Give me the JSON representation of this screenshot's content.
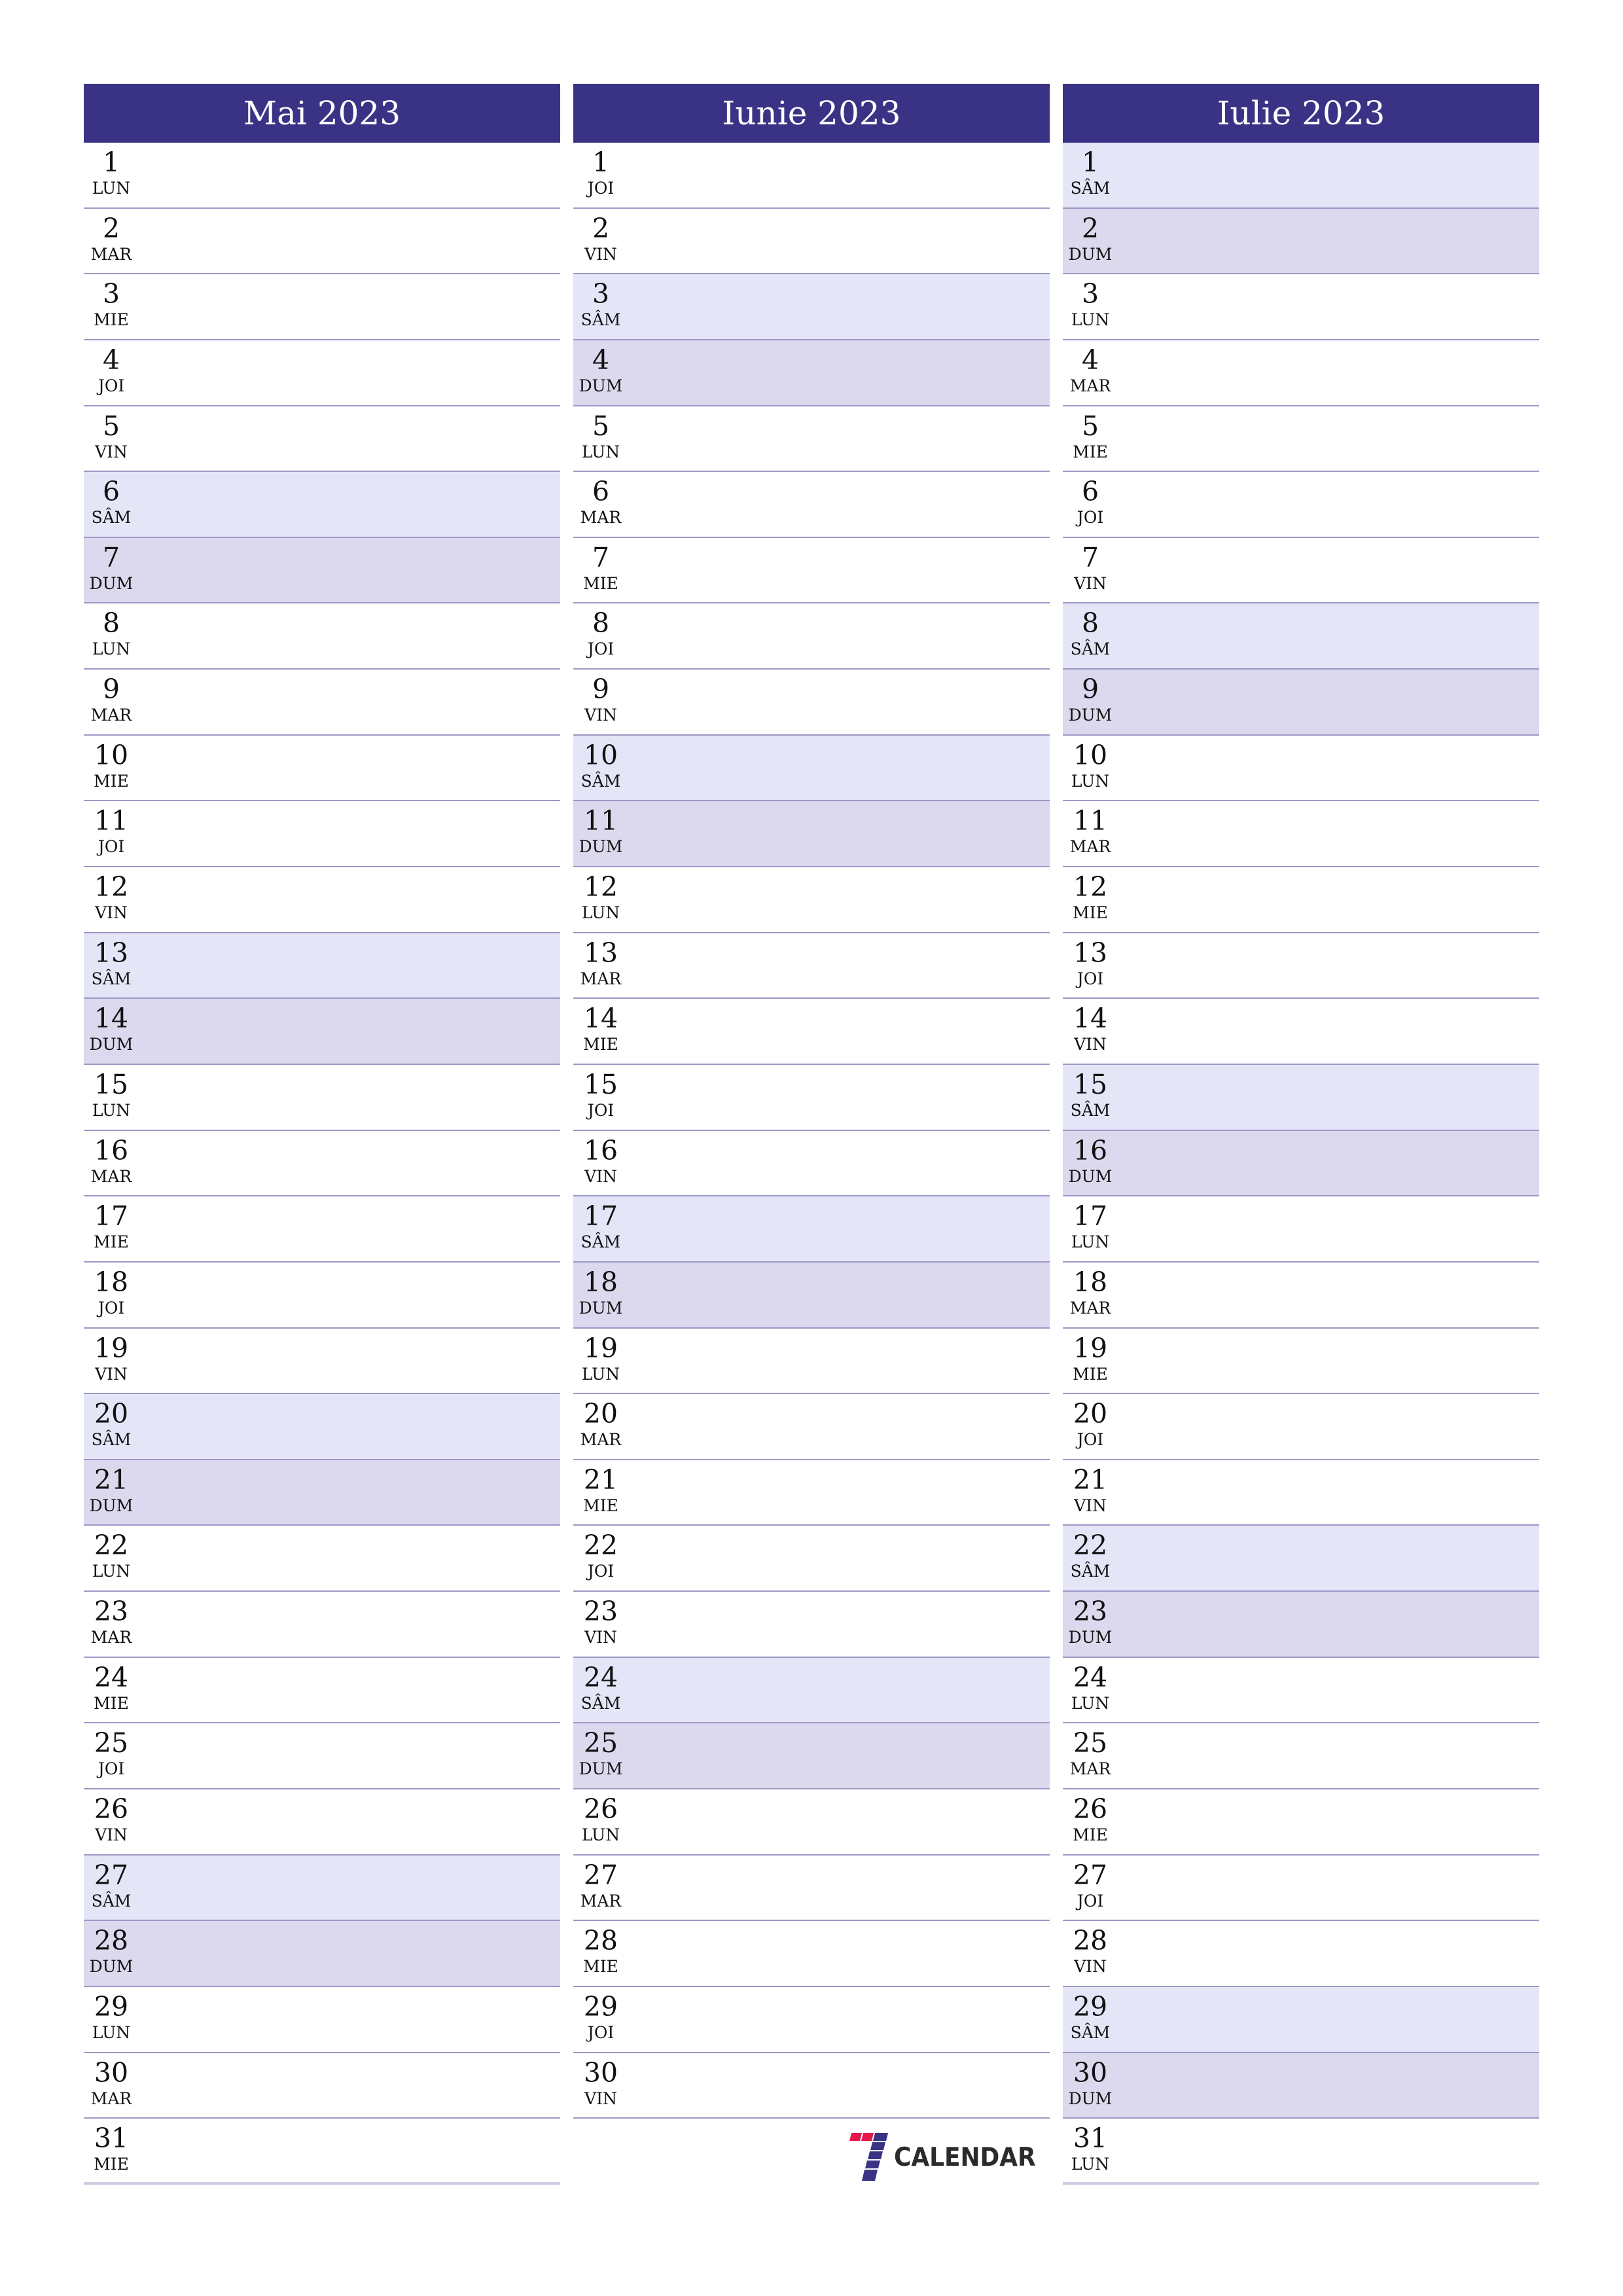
{
  "colors": {
    "header": "#3a3385",
    "saturday": "#e5e5f8",
    "sunday": "#dcd8ed",
    "divider": "#9d98c6",
    "logo_red": "#e8174a",
    "logo_blue": "#3a3385",
    "logo_text": "#2b2b2b"
  },
  "months": [
    {
      "title": "Mai 2023",
      "days": [
        {
          "n": "1",
          "d": "LUN"
        },
        {
          "n": "2",
          "d": "MAR"
        },
        {
          "n": "3",
          "d": "MIE"
        },
        {
          "n": "4",
          "d": "JOI"
        },
        {
          "n": "5",
          "d": "VIN"
        },
        {
          "n": "6",
          "d": "SÂM"
        },
        {
          "n": "7",
          "d": "DUM"
        },
        {
          "n": "8",
          "d": "LUN"
        },
        {
          "n": "9",
          "d": "MAR"
        },
        {
          "n": "10",
          "d": "MIE"
        },
        {
          "n": "11",
          "d": "JOI"
        },
        {
          "n": "12",
          "d": "VIN"
        },
        {
          "n": "13",
          "d": "SÂM"
        },
        {
          "n": "14",
          "d": "DUM"
        },
        {
          "n": "15",
          "d": "LUN"
        },
        {
          "n": "16",
          "d": "MAR"
        },
        {
          "n": "17",
          "d": "MIE"
        },
        {
          "n": "18",
          "d": "JOI"
        },
        {
          "n": "19",
          "d": "VIN"
        },
        {
          "n": "20",
          "d": "SÂM"
        },
        {
          "n": "21",
          "d": "DUM"
        },
        {
          "n": "22",
          "d": "LUN"
        },
        {
          "n": "23",
          "d": "MAR"
        },
        {
          "n": "24",
          "d": "MIE"
        },
        {
          "n": "25",
          "d": "JOI"
        },
        {
          "n": "26",
          "d": "VIN"
        },
        {
          "n": "27",
          "d": "SÂM"
        },
        {
          "n": "28",
          "d": "DUM"
        },
        {
          "n": "29",
          "d": "LUN"
        },
        {
          "n": "30",
          "d": "MAR"
        },
        {
          "n": "31",
          "d": "MIE"
        }
      ]
    },
    {
      "title": "Iunie 2023",
      "days": [
        {
          "n": "1",
          "d": "JOI"
        },
        {
          "n": "2",
          "d": "VIN"
        },
        {
          "n": "3",
          "d": "SÂM"
        },
        {
          "n": "4",
          "d": "DUM"
        },
        {
          "n": "5",
          "d": "LUN"
        },
        {
          "n": "6",
          "d": "MAR"
        },
        {
          "n": "7",
          "d": "MIE"
        },
        {
          "n": "8",
          "d": "JOI"
        },
        {
          "n": "9",
          "d": "VIN"
        },
        {
          "n": "10",
          "d": "SÂM"
        },
        {
          "n": "11",
          "d": "DUM"
        },
        {
          "n": "12",
          "d": "LUN"
        },
        {
          "n": "13",
          "d": "MAR"
        },
        {
          "n": "14",
          "d": "MIE"
        },
        {
          "n": "15",
          "d": "JOI"
        },
        {
          "n": "16",
          "d": "VIN"
        },
        {
          "n": "17",
          "d": "SÂM"
        },
        {
          "n": "18",
          "d": "DUM"
        },
        {
          "n": "19",
          "d": "LUN"
        },
        {
          "n": "20",
          "d": "MAR"
        },
        {
          "n": "21",
          "d": "MIE"
        },
        {
          "n": "22",
          "d": "JOI"
        },
        {
          "n": "23",
          "d": "VIN"
        },
        {
          "n": "24",
          "d": "SÂM"
        },
        {
          "n": "25",
          "d": "DUM"
        },
        {
          "n": "26",
          "d": "LUN"
        },
        {
          "n": "27",
          "d": "MAR"
        },
        {
          "n": "28",
          "d": "MIE"
        },
        {
          "n": "29",
          "d": "JOI"
        },
        {
          "n": "30",
          "d": "VIN"
        }
      ]
    },
    {
      "title": "Iulie 2023",
      "days": [
        {
          "n": "1",
          "d": "SÂM"
        },
        {
          "n": "2",
          "d": "DUM"
        },
        {
          "n": "3",
          "d": "LUN"
        },
        {
          "n": "4",
          "d": "MAR"
        },
        {
          "n": "5",
          "d": "MIE"
        },
        {
          "n": "6",
          "d": "JOI"
        },
        {
          "n": "7",
          "d": "VIN"
        },
        {
          "n": "8",
          "d": "SÂM"
        },
        {
          "n": "9",
          "d": "DUM"
        },
        {
          "n": "10",
          "d": "LUN"
        },
        {
          "n": "11",
          "d": "MAR"
        },
        {
          "n": "12",
          "d": "MIE"
        },
        {
          "n": "13",
          "d": "JOI"
        },
        {
          "n": "14",
          "d": "VIN"
        },
        {
          "n": "15",
          "d": "SÂM"
        },
        {
          "n": "16",
          "d": "DUM"
        },
        {
          "n": "17",
          "d": "LUN"
        },
        {
          "n": "18",
          "d": "MAR"
        },
        {
          "n": "19",
          "d": "MIE"
        },
        {
          "n": "20",
          "d": "JOI"
        },
        {
          "n": "21",
          "d": "VIN"
        },
        {
          "n": "22",
          "d": "SÂM"
        },
        {
          "n": "23",
          "d": "DUM"
        },
        {
          "n": "24",
          "d": "LUN"
        },
        {
          "n": "25",
          "d": "MAR"
        },
        {
          "n": "26",
          "d": "MIE"
        },
        {
          "n": "27",
          "d": "JOI"
        },
        {
          "n": "28",
          "d": "VIN"
        },
        {
          "n": "29",
          "d": "SÂM"
        },
        {
          "n": "30",
          "d": "DUM"
        },
        {
          "n": "31",
          "d": "LUN"
        }
      ]
    }
  ],
  "weekend": {
    "saturday": "SÂM",
    "sunday": "DUM"
  },
  "logo": {
    "text": "CALENDAR",
    "icon": "seven-calendar-logo-icon"
  }
}
